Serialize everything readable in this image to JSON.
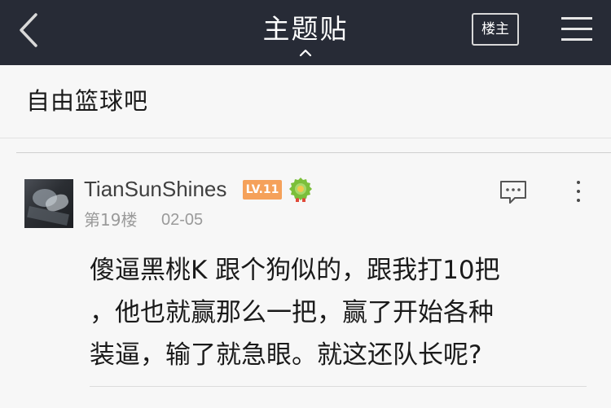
{
  "header": {
    "title": "主题贴",
    "owner_button": "楼主",
    "back_icon": "chevron-left-icon",
    "menu_icon": "hamburger-menu-icon",
    "caret_icon": "caret-up-icon",
    "background": "#272b36"
  },
  "forum": {
    "name": "自由篮球吧"
  },
  "post": {
    "username": "TianSunShines",
    "level_badge": "LV.11",
    "floor": "第19楼",
    "date": "02-05",
    "medal_icon": "medal-icon",
    "comment_icon": "comment-icon",
    "more_icon": "more-vertical-icon",
    "content_lines": [
      "傻逼黑桃K 跟个狗似的，跟我打10把",
      "，他也就赢那么一把，赢了开始各种",
      "装逼，输了就急眼。就这还队长呢?"
    ],
    "badge_color": "#f5a15a"
  }
}
